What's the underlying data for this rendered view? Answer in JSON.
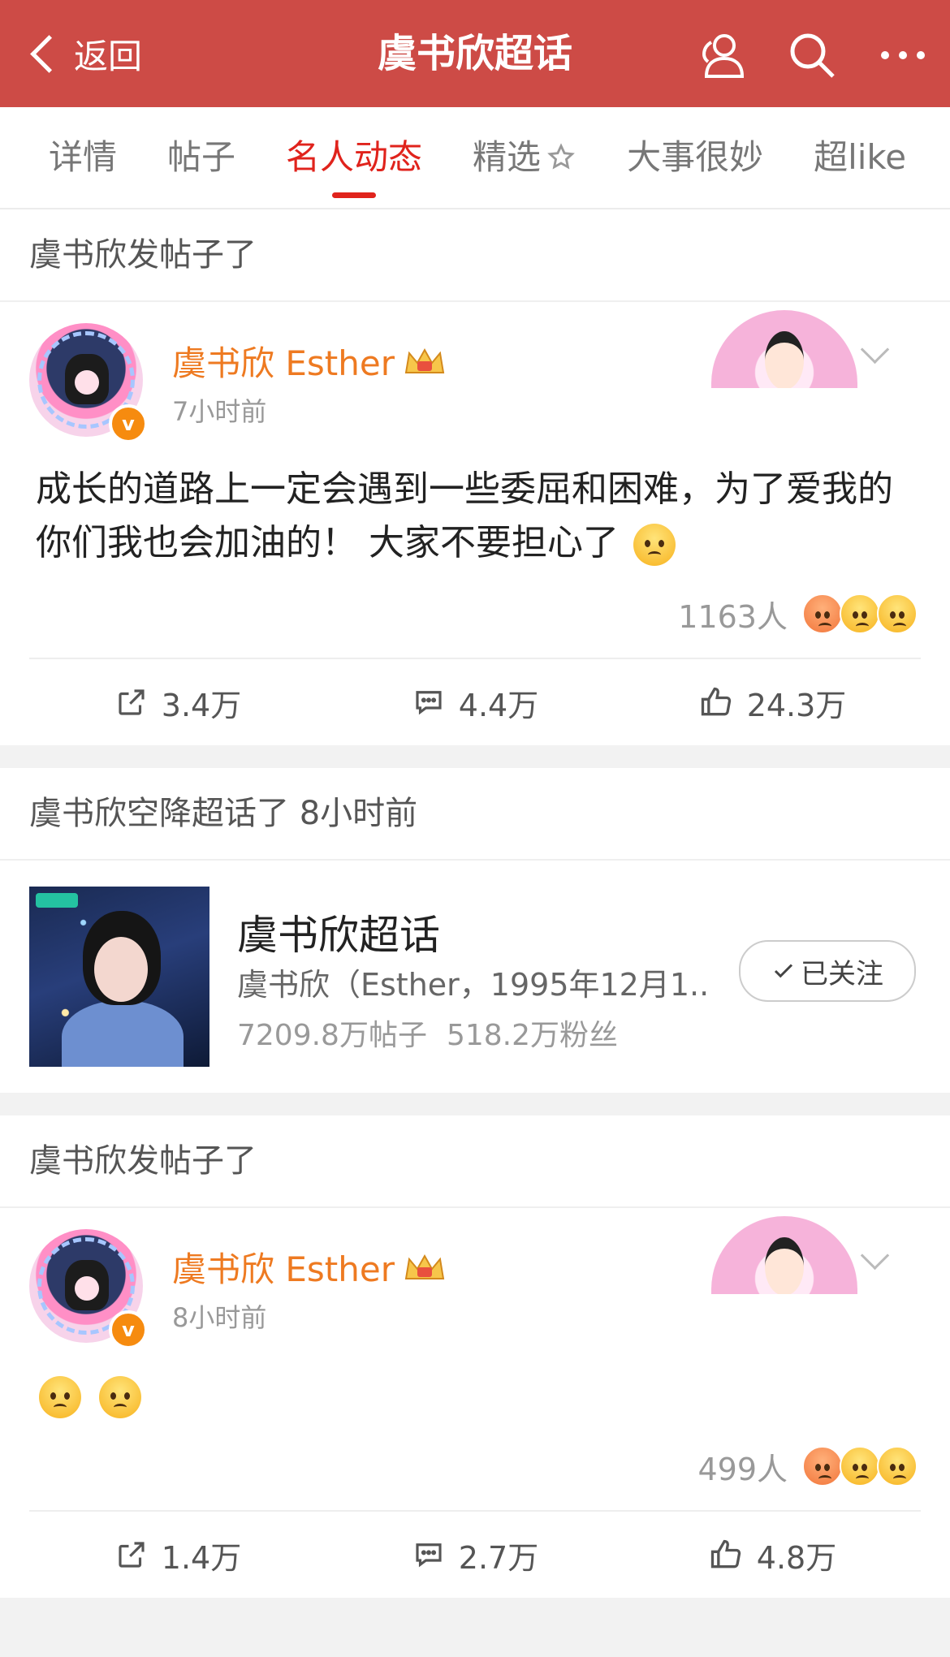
{
  "header": {
    "back_label": "返回",
    "title": "虞书欣超话",
    "icons": [
      "people-icon",
      "search-icon",
      "more-icon"
    ]
  },
  "tabs": [
    {
      "label": "详情"
    },
    {
      "label": "帖子"
    },
    {
      "label": "名人动态",
      "active": true
    },
    {
      "label": "精选"
    },
    {
      "label": "大事很妙"
    },
    {
      "label": "超like"
    }
  ],
  "feed": {
    "post1": {
      "section": "虞书欣发帖子了",
      "author": "虞书欣 Esther",
      "time": "7小时前",
      "text": "成长的道路上一定会遇到一些委屈和困难，为了爱我的你们我也会加油的！ 大家不要担心了",
      "react_count": "1163人",
      "repost": "3.4万",
      "comment": "4.4万",
      "like": "24.3万"
    },
    "topic": {
      "section": "虞书欣空降超话了 8小时前",
      "name": "虞书欣超话",
      "desc": "虞书欣（Esther，1995年12月1...",
      "posts": "7209.8万帖子",
      "fans": "518.2万粉丝",
      "follow_label": "已关注"
    },
    "post2": {
      "section": "虞书欣发帖子了",
      "author": "虞书欣 Esther",
      "time": "8小时前",
      "react_count": "499人",
      "repost": "1.4万",
      "comment": "2.7万",
      "like": "4.8万"
    }
  },
  "colors": {
    "header_bg": "#cd4b46",
    "accent": "#e0231c",
    "username": "#ee7a21"
  }
}
